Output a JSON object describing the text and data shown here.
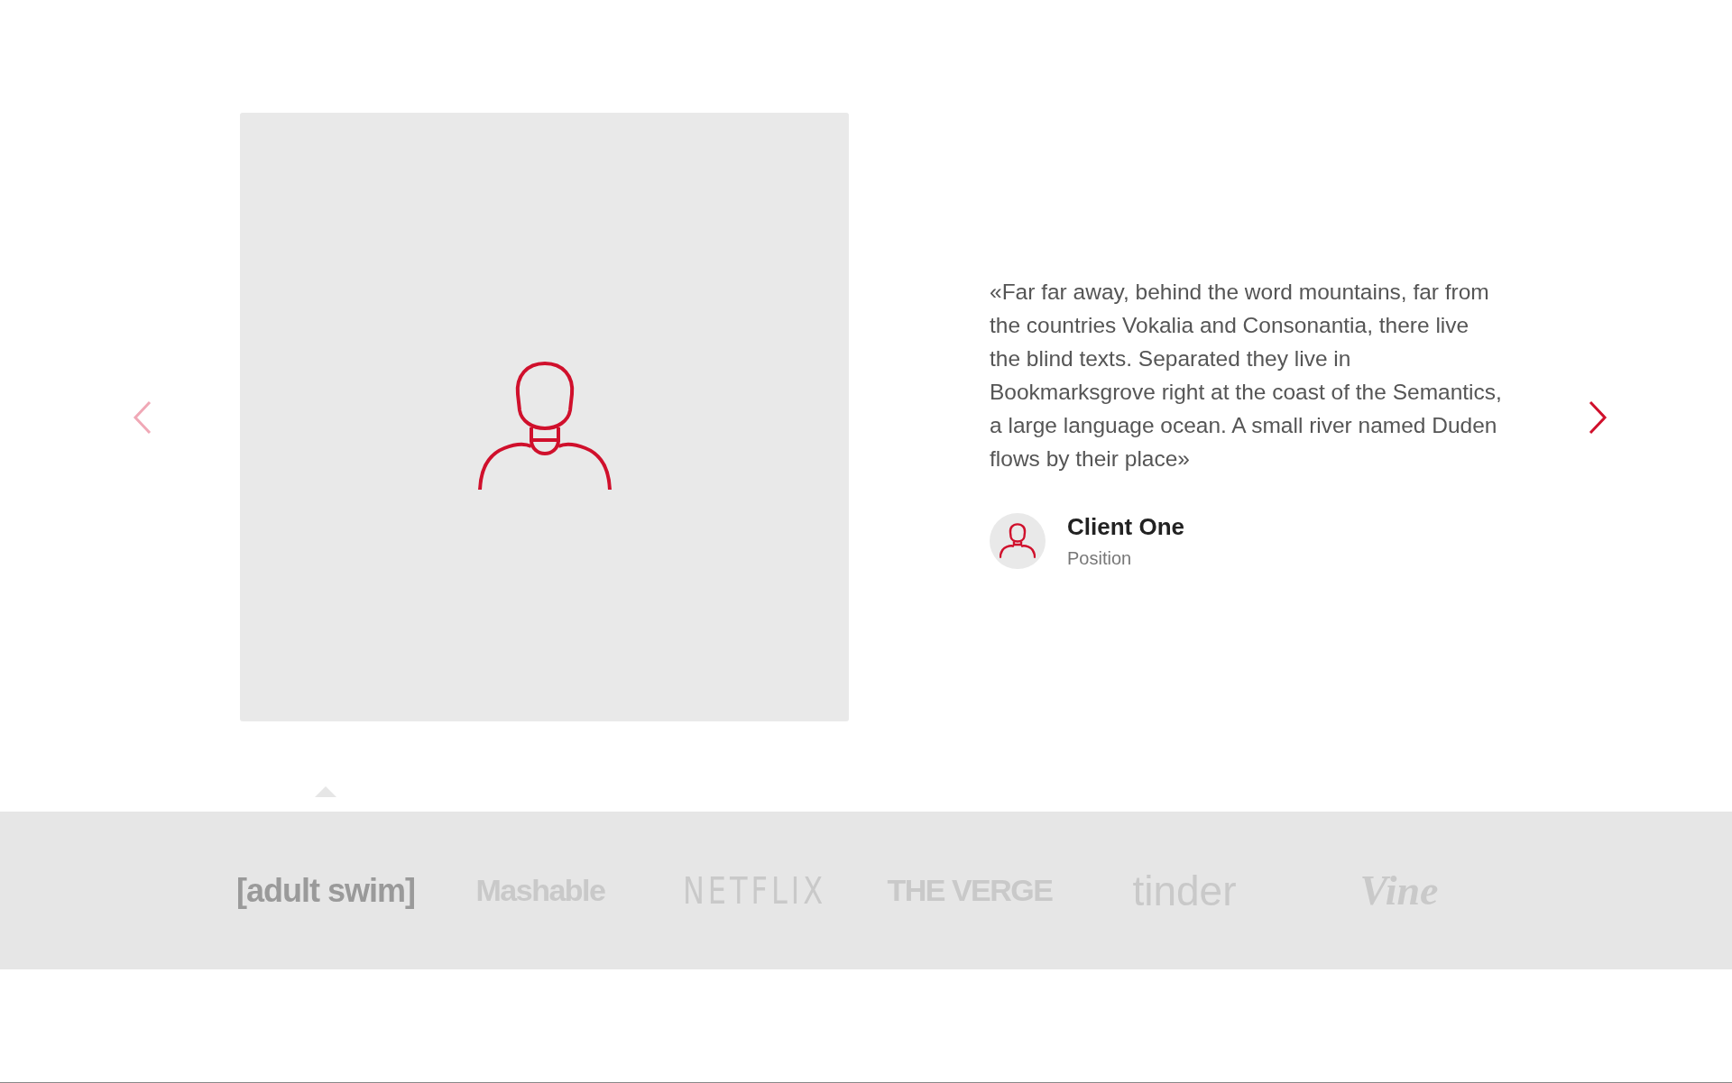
{
  "testimonial": {
    "quote": "«Far far away, behind the word mountains, far from the countries Vokalia and Consonantia, there live the blind texts. Separated they live in Bookmarksgrove right at the coast of the Semantics, a large language ocean. A small river named Duden flows by their place»",
    "client_name": "Client One",
    "client_position": "Position"
  },
  "nav": {
    "previous_disabled": true,
    "next_disabled": false
  },
  "logos": [
    {
      "text": "[adult swim]",
      "kind": "bracket",
      "selected": true
    },
    {
      "text": "Mashable",
      "kind": "heavy",
      "selected": false
    },
    {
      "text": "NETFLIX",
      "kind": "condensed",
      "selected": false
    },
    {
      "text": "THE VERGE",
      "kind": "heavy",
      "selected": false
    },
    {
      "text": "tinder",
      "kind": "round",
      "selected": false
    },
    {
      "text": "Vine",
      "kind": "script",
      "selected": false
    }
  ]
}
